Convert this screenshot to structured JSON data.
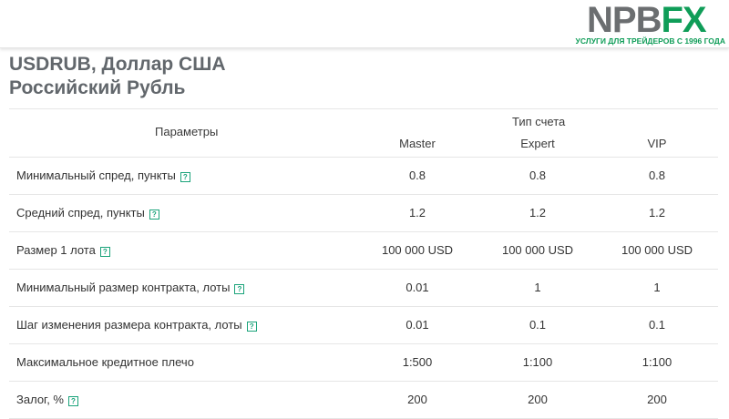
{
  "logo": {
    "word_main": "NPB",
    "word_accent": "FX",
    "tagline": "УСЛУГИ ДЛЯ ТРЕЙДЕРОВ С 1996 ГОДА",
    "colors": {
      "main": "#6b6e70",
      "accent": "#0f9d58"
    }
  },
  "title": {
    "line1": "USDRUB, Доллар США",
    "line2": "Российский Рубль"
  },
  "table": {
    "header_params": "Параметры",
    "header_type": "Тип счета",
    "columns": [
      "Master",
      "Expert",
      "VIP"
    ],
    "help_icon": "?",
    "rows": [
      {
        "label": "Минимальный спред, пункты",
        "has_help": true,
        "values": [
          "0.8",
          "0.8",
          "0.8"
        ]
      },
      {
        "label": "Средний спред, пункты",
        "has_help": true,
        "values": [
          "1.2",
          "1.2",
          "1.2"
        ]
      },
      {
        "label": "Размер 1 лота",
        "has_help": true,
        "values": [
          "100 000 USD",
          "100 000 USD",
          "100 000 USD"
        ]
      },
      {
        "label": "Минимальный размер контракта, лоты",
        "has_help": true,
        "values": [
          "0.01",
          "1",
          "1"
        ]
      },
      {
        "label": "Шаг изменения размера контракта, лоты",
        "has_help": true,
        "values": [
          "0.01",
          "0.1",
          "0.1"
        ]
      },
      {
        "label": "Максимальное кредитное плечо",
        "has_help": false,
        "values": [
          "1:500",
          "1:100",
          "1:100"
        ]
      },
      {
        "label": "Залог, %",
        "has_help": true,
        "values": [
          "200",
          "200",
          "200"
        ]
      }
    ]
  },
  "colors": {
    "help_icon": "#1aa37a",
    "title": "#62676c",
    "divider": "#e6e6e6"
  }
}
